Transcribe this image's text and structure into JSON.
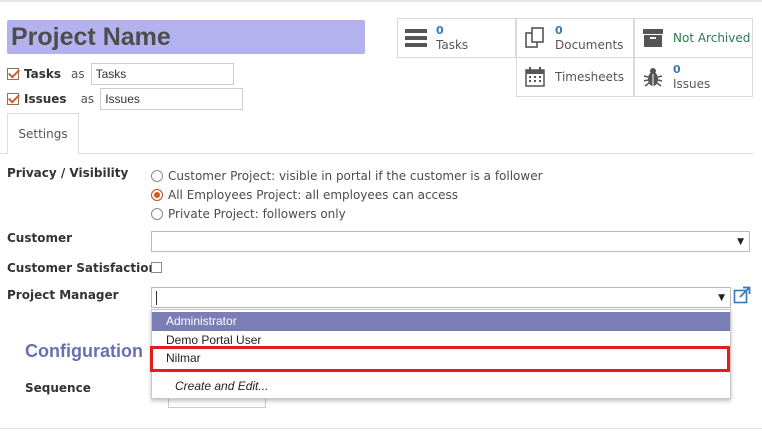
{
  "project": {
    "name": "Project Name"
  },
  "labels": {
    "tasks": {
      "checkbox_label": "Tasks",
      "as": "as",
      "value": "Tasks"
    },
    "issues": {
      "checkbox_label": "Issues",
      "as": "as",
      "value": "Issues"
    }
  },
  "stats": [
    {
      "count": "0",
      "name": "Tasks",
      "icon": "tasks-list-icon"
    },
    {
      "count": "0",
      "name": "Documents",
      "icon": "documents-icon"
    },
    {
      "count": "",
      "name": "Not Archived",
      "icon": "archive-box-icon"
    },
    {
      "count": "",
      "name": "Timesheets",
      "icon": "calendar-icon"
    },
    {
      "count": "0",
      "name": "Issues",
      "icon": "bug-icon"
    }
  ],
  "tabs": [
    {
      "label": "Settings"
    }
  ],
  "form": {
    "privacy_label": "Privacy / Visibility",
    "privacy_options": [
      {
        "label": "Customer Project: visible in portal if the customer is a follower",
        "selected": false
      },
      {
        "label": "All Employees Project: all employees can access",
        "selected": true
      },
      {
        "label": "Private Project: followers only",
        "selected": false
      }
    ],
    "customer_label": "Customer",
    "customer_value": "",
    "satisfaction_label": "Customer Satisfaction",
    "manager_label": "Project Manager",
    "manager_value": ""
  },
  "configuration": {
    "title": "Configuration",
    "sequence_label": "Sequence"
  },
  "dropdown": {
    "items": [
      {
        "label": "Administrator",
        "active": true
      },
      {
        "label": "Demo Portal User",
        "active": false
      },
      {
        "label": "Nilmar",
        "active": false
      }
    ],
    "create_edit": "Create and Edit..."
  },
  "colors": {
    "accent": "#7b7db6",
    "title_bg": "#b4b2ee",
    "count_blue": "#337ab7",
    "not_archived_green": "#2a7a4f",
    "highlight_red": "#e11d1d",
    "radio_orange": "#d9582a"
  }
}
